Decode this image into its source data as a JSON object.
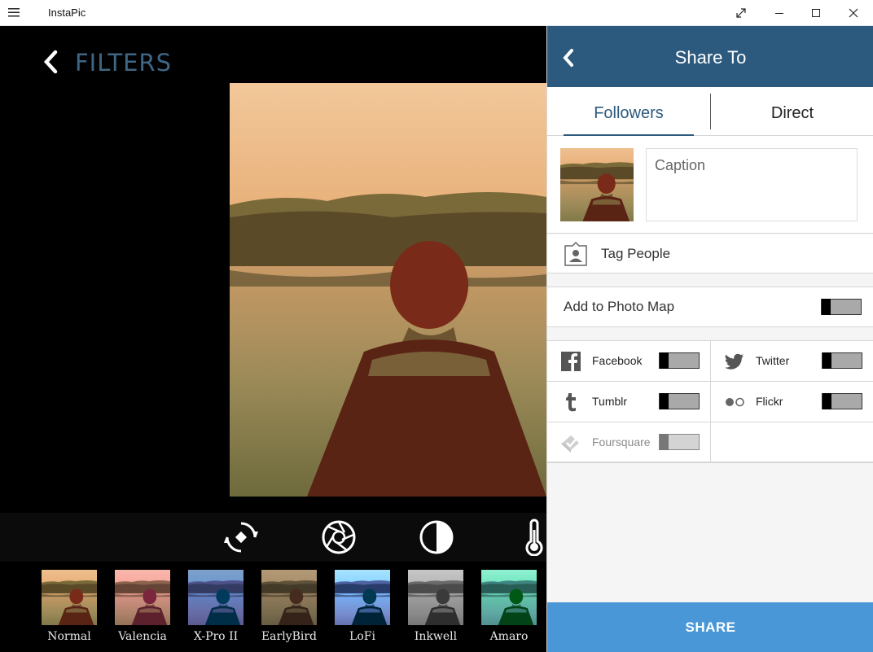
{
  "window": {
    "title": "InstaPic"
  },
  "editor": {
    "title": "FILTERS",
    "tools": [
      "rotate-icon",
      "aperture-icon",
      "contrast-icon",
      "temperature-icon"
    ],
    "filters": [
      {
        "label": "Normal"
      },
      {
        "label": "Valencia"
      },
      {
        "label": "X-Pro II"
      },
      {
        "label": "EarlyBird"
      },
      {
        "label": "LoFi"
      },
      {
        "label": "Inkwell"
      },
      {
        "label": "Amaro"
      }
    ]
  },
  "share": {
    "title": "Share To",
    "tabs": [
      {
        "label": "Followers",
        "active": true
      },
      {
        "label": "Direct",
        "active": false
      }
    ],
    "caption_placeholder": "Caption",
    "tag_people": "Tag People",
    "photo_map": "Add to Photo Map",
    "networks": [
      {
        "label": "Facebook",
        "icon": "facebook-icon",
        "enabled": true,
        "on": false
      },
      {
        "label": "Twitter",
        "icon": "twitter-icon",
        "enabled": true,
        "on": false
      },
      {
        "label": "Tumblr",
        "icon": "tumblr-icon",
        "enabled": true,
        "on": false
      },
      {
        "label": "Flickr",
        "icon": "flickr-icon",
        "enabled": true,
        "on": false
      },
      {
        "label": "Foursquare",
        "icon": "foursquare-icon",
        "enabled": false,
        "on": false
      }
    ],
    "button": "SHARE"
  },
  "colors": {
    "header": "#2c5a7e",
    "accent": "#3f6685",
    "share_button": "#4a97d8"
  }
}
